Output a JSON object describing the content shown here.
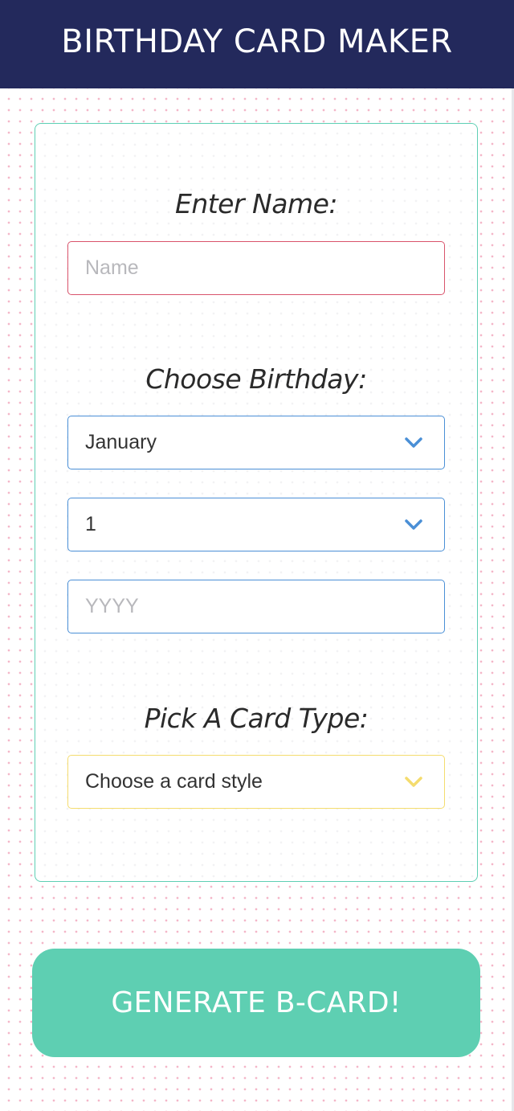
{
  "header": {
    "title": "BIRTHDAY CARD MAKER"
  },
  "name_section": {
    "label": "Enter Name:",
    "input": {
      "value": "",
      "placeholder": "Name"
    }
  },
  "birthday_section": {
    "label": "Choose Birthday:",
    "month_select": {
      "selected": "January"
    },
    "day_select": {
      "selected": "1"
    },
    "year_input": {
      "value": "",
      "placeholder": "YYYY"
    }
  },
  "card_section": {
    "label": "Pick A Card Type:",
    "style_select": {
      "selected": "Choose a card style"
    }
  },
  "generate_button": {
    "label": "GENERATE B-CARD!"
  },
  "colors": {
    "header_bg": "#23295c",
    "accent_teal": "#5ecfb2",
    "name_border": "#d9546c",
    "birthday_border": "#4a8fd6",
    "card_border": "#f4dc6e",
    "dot_pattern": "#f4b6c8"
  },
  "icons": {
    "month_chevron": "chevron-down-icon",
    "day_chevron": "chevron-down-icon",
    "card_chevron": "chevron-down-icon"
  }
}
